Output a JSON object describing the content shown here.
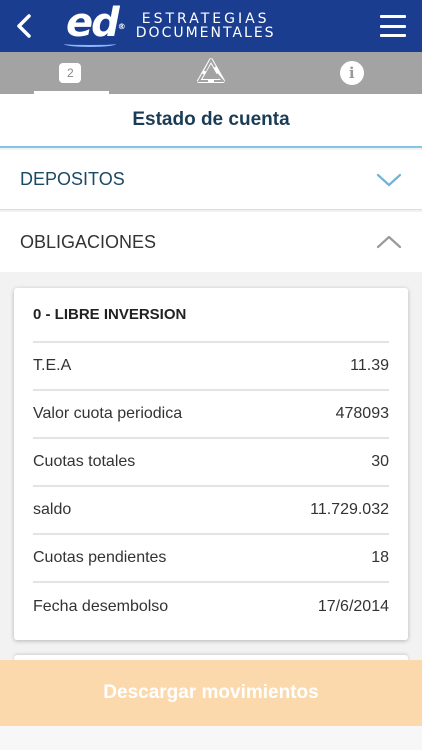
{
  "header": {
    "logo_mark": "ed",
    "logo_reg": "®",
    "logo_line1": "ESTRATEGIAS",
    "logo_line2": "DOCUMENTALES",
    "back_icon": "chevron-left-icon",
    "menu_icon": "hamburger-menu-icon",
    "bg_color": "#1a3d8f"
  },
  "tabs": [
    {
      "badge": "2",
      "icon": "badge-count"
    },
    {
      "icon": "recycle-triangle-icon"
    },
    {
      "icon": "info-icon",
      "glyph": "i"
    }
  ],
  "page": {
    "title": "Estado de cuenta",
    "accent_color": "#7fc6ea"
  },
  "sections": {
    "depositos": {
      "label": "DEPOSITOS",
      "state": "collapsed"
    },
    "obligaciones": {
      "label": "OBLIGACIONES",
      "state": "expanded"
    }
  },
  "obligation": {
    "title": "0 - LIBRE INVERSION",
    "rows": [
      {
        "label": "T.E.A",
        "value": "11.39"
      },
      {
        "label": "Valor cuota periodica",
        "value": "478093"
      },
      {
        "label": "Cuotas totales",
        "value": "30"
      },
      {
        "label": "saldo",
        "value": "11.729.032"
      },
      {
        "label": "Cuotas pendientes",
        "value": "18"
      },
      {
        "label": "Fecha desembolso",
        "value": "17/6/2014"
      }
    ]
  },
  "actions": {
    "download_label": "Descargar movimientos",
    "download_color": "#fbd9ad"
  }
}
